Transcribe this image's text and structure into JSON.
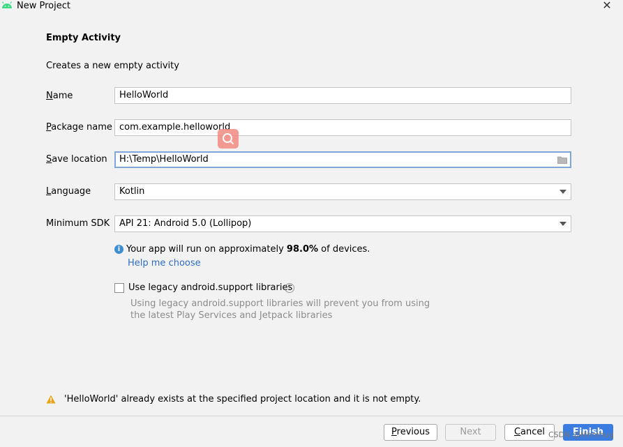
{
  "window": {
    "title": "New Project",
    "close_icon": "close-icon",
    "app_icon": "android-icon"
  },
  "page": {
    "heading": "Empty Activity",
    "description": "Creates a new empty activity"
  },
  "form": {
    "name": {
      "label_mnemonic": "N",
      "label_rest": "ame",
      "value": "HelloWorld"
    },
    "package_name": {
      "label_mnemonic": "P",
      "label_rest": "ackage name",
      "value": "com.example.helloworld"
    },
    "save_location": {
      "label_mnemonic": "S",
      "label_rest": "ave location",
      "value": "H:\\Temp\\HelloWorld",
      "icon": "folder-icon"
    },
    "language": {
      "label_mnemonic": "L",
      "label_rest": "anguage",
      "value": "Kotlin"
    },
    "minimum_sdk": {
      "label": "Minimum SDK",
      "value": "API 21: Android 5.0 (Lollipop)"
    }
  },
  "info": {
    "text_before": "Your app will run on approximately ",
    "percent": "98.0%",
    "text_after": " of devices.",
    "link": "Help me choose",
    "icon": "info-icon"
  },
  "legacy": {
    "label": "Use legacy android.support libraries",
    "checked": false,
    "hint_line1": "Using legacy android.support libraries will prevent you from using",
    "hint_line2": "the latest Play Services and Jetpack libraries",
    "help_icon": "question-icon"
  },
  "warning": {
    "text": "'HelloWorld' already exists at the specified project location and it is not empty.",
    "icon": "warning-icon",
    "color": "#e8a317"
  },
  "buttons": {
    "previous_mnemonic": "P",
    "previous_rest": "revious",
    "next": "Next",
    "cancel_mnemonic": "C",
    "cancel_rest": "ancel",
    "finish_mnemonic": "F",
    "finish_rest": "inish"
  },
  "watermark": "CSDN @Mhmhug",
  "colors": {
    "accent": "#3a7ce0",
    "link": "#2f6ebe",
    "info": "#3d8fd1",
    "android_green": "#3ddc84"
  }
}
